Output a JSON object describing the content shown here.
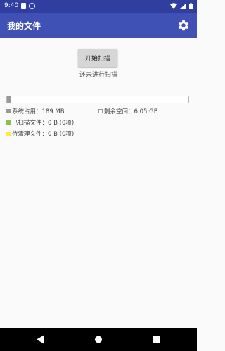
{
  "status_bar": {
    "time": "9:40"
  },
  "app_bar": {
    "title": "我的文件"
  },
  "scan": {
    "button_label": "开始扫描",
    "status": "还未进行扫描"
  },
  "storage": {
    "usage_fraction": 0.025,
    "system_used": "系统占用：189 MB",
    "free_space": "剩余空间：6.05 GB",
    "scanned_files": "已扫描文件：0 B (0项)",
    "to_clean_files": "待清理文件：0 B (0项)"
  },
  "colors": {
    "primary": "#3f51b5",
    "primary_dark": "#303f9f",
    "system_swatch": "#999999",
    "free_swatch": "#ffffff",
    "scanned_swatch": "#8bc34a",
    "to_clean_swatch": "#ffeb3b"
  }
}
